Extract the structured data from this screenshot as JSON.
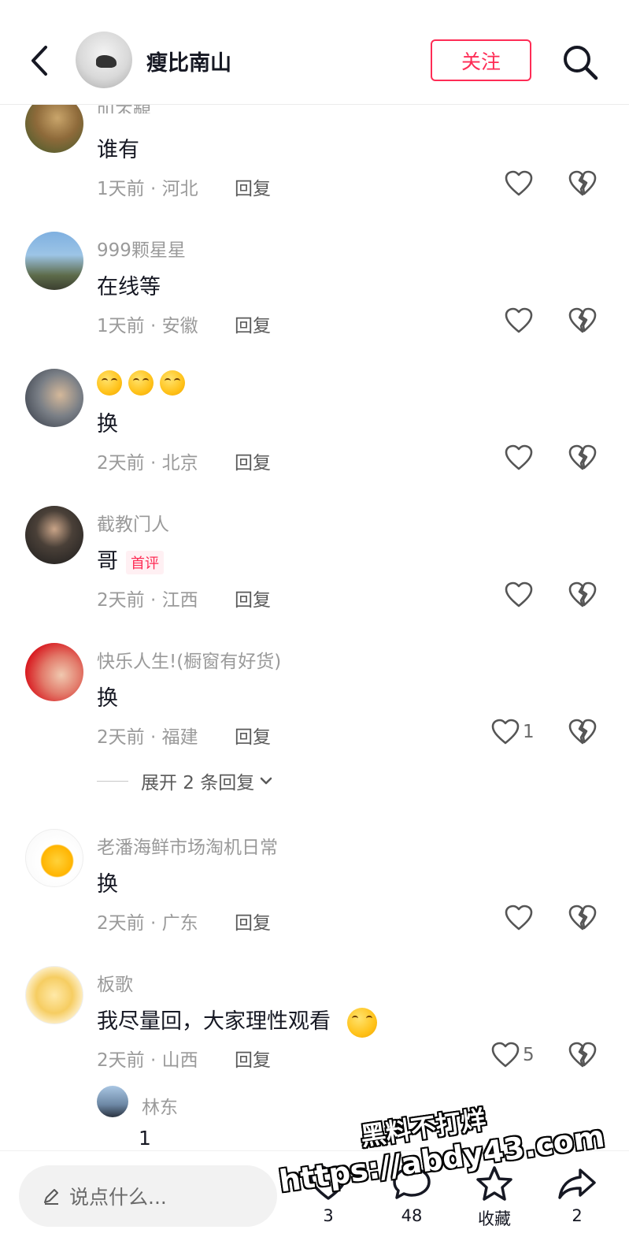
{
  "header": {
    "title": "瘦比南山",
    "follow_label": "关注",
    "back_icon": "chevron-left-icon",
    "search_icon": "search-icon"
  },
  "comments": [
    {
      "username": "叫不醒",
      "content": "谁有",
      "meta": "1天前 · 河北",
      "reply": "回复",
      "likes": ""
    },
    {
      "username": "999颗星星",
      "content": "在线等",
      "meta": "1天前 · 安徽",
      "reply": "回复",
      "likes": ""
    },
    {
      "username": "",
      "content": "换",
      "meta": "2天前 · 北京",
      "reply": "回复",
      "likes": ""
    },
    {
      "username": "截教门人",
      "content": "哥",
      "tag": "首评",
      "meta": "2天前 · 江西",
      "reply": "回复",
      "likes": ""
    },
    {
      "username": "快乐人生!(橱窗有好货)",
      "content": "换",
      "meta": "2天前 · 福建",
      "reply": "回复",
      "likes": "1",
      "expand": "展开 2 条回复"
    },
    {
      "username": "老潘海鲜市场淘机日常",
      "content": "换",
      "meta": "2天前 · 广东",
      "reply": "回复",
      "likes": ""
    },
    {
      "username": "板歌",
      "content": "我尽量回，大家理性观看",
      "meta": "2天前 · 山西",
      "reply": "回复",
      "likes": "5"
    }
  ],
  "sub_reply": {
    "username": "林东",
    "content": "1"
  },
  "bottom_bar": {
    "placeholder": "说点什么...",
    "like_count": "3",
    "comment_count": "48",
    "favorite_label": "收藏",
    "share_count": "2"
  },
  "watermark": {
    "line1": "黑料不打烊",
    "line2": "https://abdy43.com"
  },
  "colors": {
    "accent": "#fe2c55",
    "text": "#161823",
    "muted": "#9a9a9a"
  }
}
